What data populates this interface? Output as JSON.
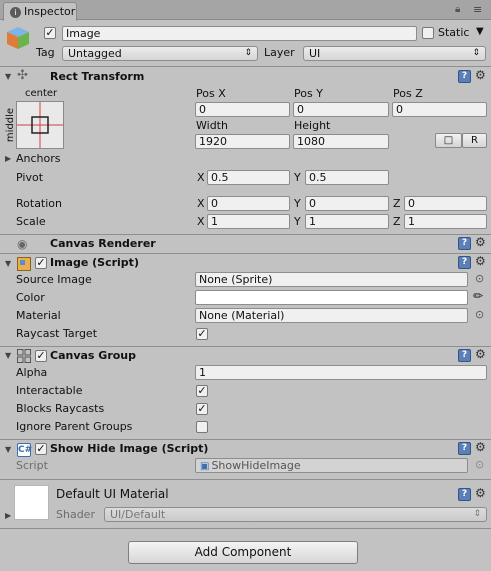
{
  "tab": {
    "title": "Inspector"
  },
  "header": {
    "name": "Image",
    "static_label": "Static",
    "tag_label": "Tag",
    "tag_value": "Untagged",
    "layer_label": "Layer",
    "layer_value": "UI"
  },
  "rect_transform": {
    "title": "Rect Transform",
    "anchor_h": "center",
    "anchor_v": "middle",
    "posx_label": "Pos X",
    "posy_label": "Pos Y",
    "posz_label": "Pos Z",
    "posx": "0",
    "posy": "0",
    "posz": "0",
    "width_label": "Width",
    "height_label": "Height",
    "width": "1920",
    "height": "1080",
    "r_label": "R",
    "anchors_label": "Anchors",
    "pivot_label": "Pivot",
    "pivot_x": "0.5",
    "pivot_y": "0.5",
    "rotation_label": "Rotation",
    "rot_x": "0",
    "rot_y": "0",
    "rot_z": "0",
    "scale_label": "Scale",
    "scale_x": "1",
    "scale_y": "1",
    "scale_z": "1",
    "x": "X",
    "y": "Y",
    "z": "Z"
  },
  "canvas_renderer": {
    "title": "Canvas Renderer"
  },
  "image_script": {
    "title": "Image (Script)",
    "source_label": "Source Image",
    "source_value": "None (Sprite)",
    "color_label": "Color",
    "color_value": "#ffffff",
    "material_label": "Material",
    "material_value": "None (Material)",
    "raycast_label": "Raycast Target",
    "raycast_checked": true
  },
  "canvas_group": {
    "title": "Canvas Group",
    "alpha_label": "Alpha",
    "alpha_value": "1",
    "interactable_label": "Interactable",
    "interactable_checked": true,
    "blocks_label": "Blocks Raycasts",
    "blocks_checked": true,
    "ignore_label": "Ignore Parent Groups",
    "ignore_checked": false
  },
  "show_hide": {
    "title": "Show Hide Image (Script)",
    "script_label": "Script",
    "script_value": "ShowHideImage"
  },
  "material": {
    "title": "Default UI Material",
    "shader_label": "Shader",
    "shader_value": "UI/Default"
  },
  "footer": {
    "add_component": "Add Component"
  },
  "icons": {
    "help": "help-book-icon",
    "gear": "gear-icon",
    "lock": "lock-icon",
    "menu": "menu-icon"
  },
  "colors": {
    "panel_bg": "#c2c2c2",
    "tab_bg": "#a5a5a5",
    "help_blue": "#5b7fb6"
  }
}
